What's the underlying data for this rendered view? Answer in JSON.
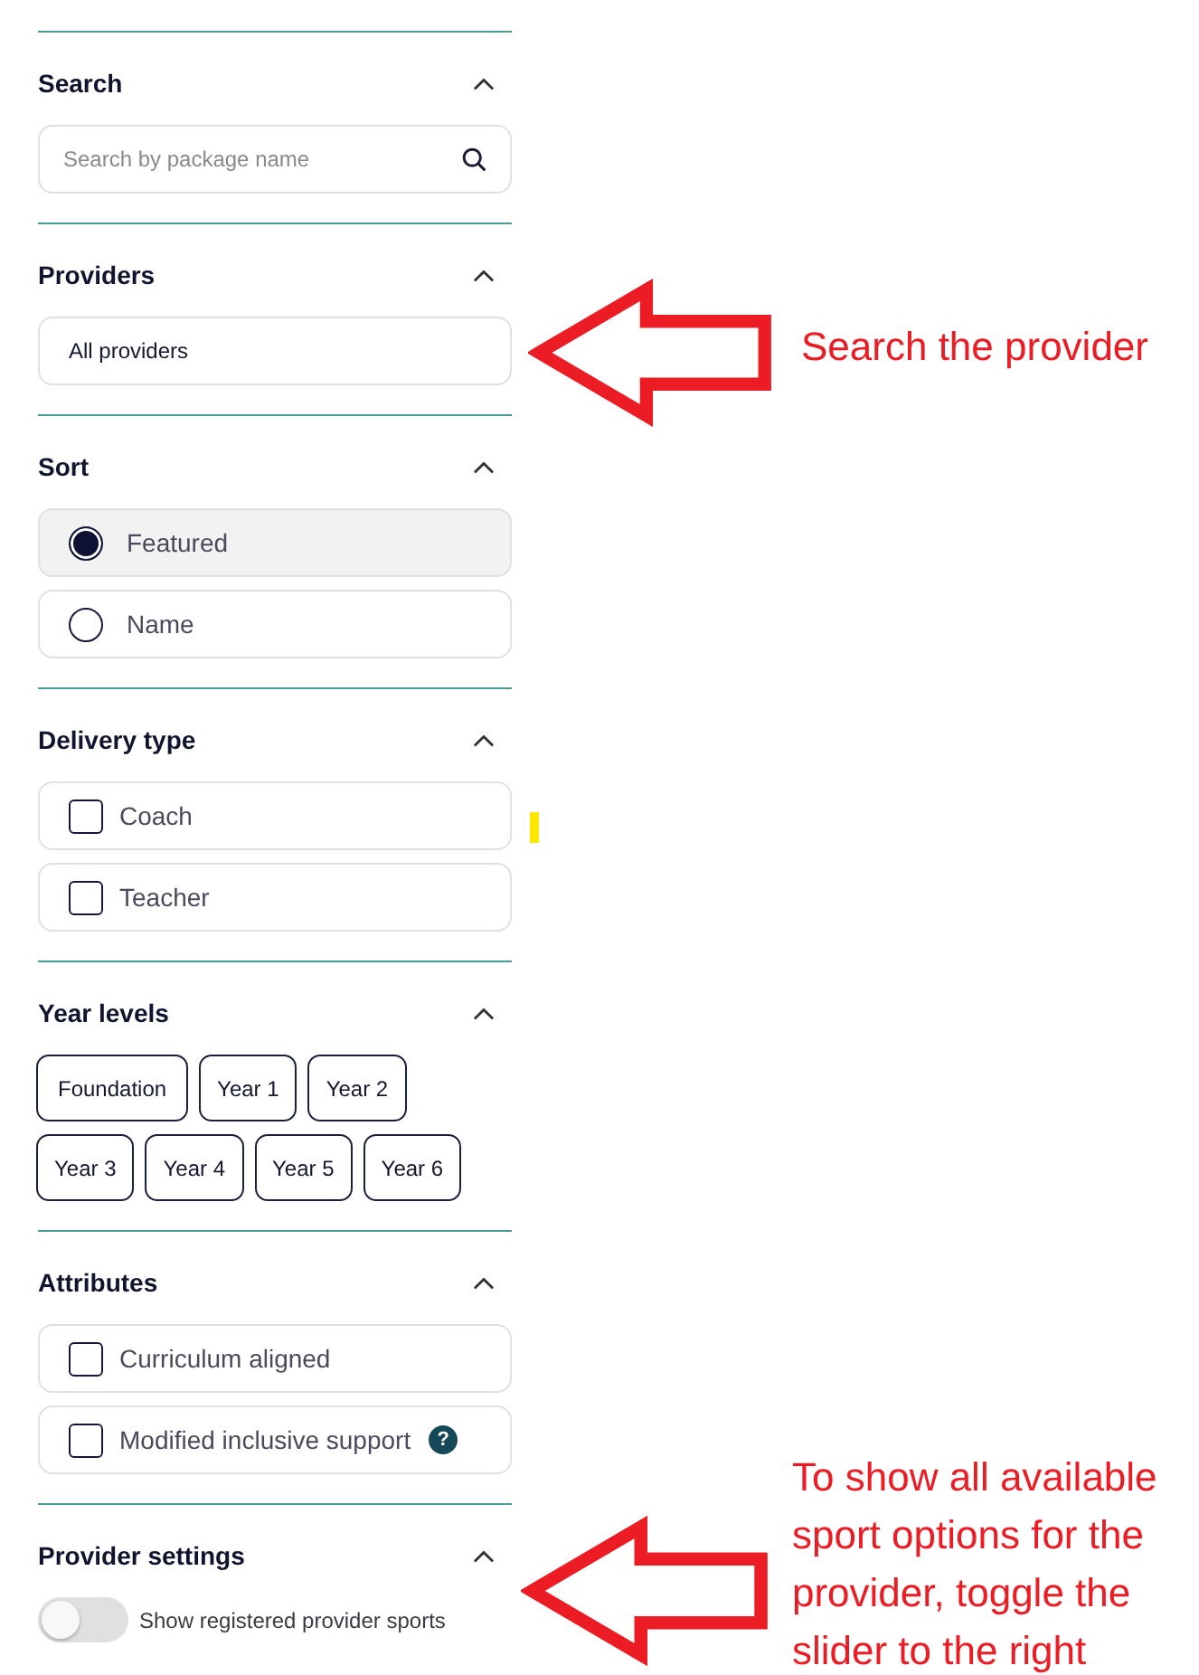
{
  "filters": [
    {
      "kind": "search",
      "title": "Search",
      "expanded": true,
      "placeholder": "Search by package name"
    },
    {
      "kind": "select",
      "title": "Providers",
      "expanded": true,
      "value": "All providers"
    },
    {
      "kind": "radio",
      "title": "Sort",
      "expanded": true,
      "options": [
        {
          "label": "Featured",
          "selected": true
        },
        {
          "label": "Name",
          "selected": false
        }
      ]
    },
    {
      "kind": "checkbox",
      "title": "Delivery type",
      "expanded": true,
      "options": [
        {
          "label": "Coach",
          "checked": false
        },
        {
          "label": "Teacher",
          "checked": false
        }
      ]
    },
    {
      "kind": "chips",
      "title": "Year levels",
      "expanded": true,
      "options": [
        {
          "label": "Foundation",
          "selected": false
        },
        {
          "label": "Year 1",
          "selected": false
        },
        {
          "label": "Year 2",
          "selected": false
        },
        {
          "label": "Year 3",
          "selected": false
        },
        {
          "label": "Year 4",
          "selected": false
        },
        {
          "label": "Year 5",
          "selected": false
        },
        {
          "label": "Year 6",
          "selected": false
        }
      ]
    },
    {
      "kind": "checkbox",
      "title": "Attributes",
      "expanded": true,
      "options": [
        {
          "label": "Curriculum aligned",
          "checked": false
        },
        {
          "label": "Modified inclusive support",
          "checked": false,
          "help": "?"
        }
      ]
    },
    {
      "kind": "toggle",
      "title": "Provider settings",
      "expanded": true,
      "label": "Show registered provider sports",
      "on": false
    }
  ],
  "annotations": [
    {
      "kind": "callout",
      "text": "Search the provider"
    },
    {
      "kind": "callout",
      "text": "To show all available sport options for the provider, toggle the slider to the right"
    },
    {
      "kind": "highlight"
    }
  ]
}
